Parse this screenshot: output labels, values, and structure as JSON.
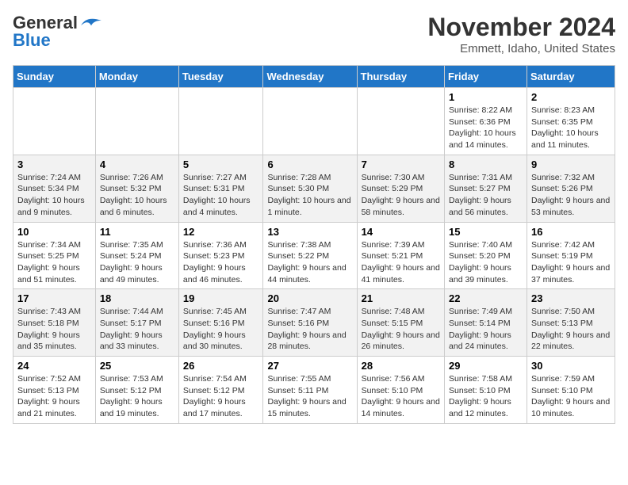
{
  "logo": {
    "general": "General",
    "blue": "Blue"
  },
  "title": "November 2024",
  "location": "Emmett, Idaho, United States",
  "days_of_week": [
    "Sunday",
    "Monday",
    "Tuesday",
    "Wednesday",
    "Thursday",
    "Friday",
    "Saturday"
  ],
  "weeks": [
    [
      {
        "day": "",
        "info": ""
      },
      {
        "day": "",
        "info": ""
      },
      {
        "day": "",
        "info": ""
      },
      {
        "day": "",
        "info": ""
      },
      {
        "day": "",
        "info": ""
      },
      {
        "day": "1",
        "info": "Sunrise: 8:22 AM\nSunset: 6:36 PM\nDaylight: 10 hours and 14 minutes."
      },
      {
        "day": "2",
        "info": "Sunrise: 8:23 AM\nSunset: 6:35 PM\nDaylight: 10 hours and 11 minutes."
      }
    ],
    [
      {
        "day": "3",
        "info": "Sunrise: 7:24 AM\nSunset: 5:34 PM\nDaylight: 10 hours and 9 minutes."
      },
      {
        "day": "4",
        "info": "Sunrise: 7:26 AM\nSunset: 5:32 PM\nDaylight: 10 hours and 6 minutes."
      },
      {
        "day": "5",
        "info": "Sunrise: 7:27 AM\nSunset: 5:31 PM\nDaylight: 10 hours and 4 minutes."
      },
      {
        "day": "6",
        "info": "Sunrise: 7:28 AM\nSunset: 5:30 PM\nDaylight: 10 hours and 1 minute."
      },
      {
        "day": "7",
        "info": "Sunrise: 7:30 AM\nSunset: 5:29 PM\nDaylight: 9 hours and 58 minutes."
      },
      {
        "day": "8",
        "info": "Sunrise: 7:31 AM\nSunset: 5:27 PM\nDaylight: 9 hours and 56 minutes."
      },
      {
        "day": "9",
        "info": "Sunrise: 7:32 AM\nSunset: 5:26 PM\nDaylight: 9 hours and 53 minutes."
      }
    ],
    [
      {
        "day": "10",
        "info": "Sunrise: 7:34 AM\nSunset: 5:25 PM\nDaylight: 9 hours and 51 minutes."
      },
      {
        "day": "11",
        "info": "Sunrise: 7:35 AM\nSunset: 5:24 PM\nDaylight: 9 hours and 49 minutes."
      },
      {
        "day": "12",
        "info": "Sunrise: 7:36 AM\nSunset: 5:23 PM\nDaylight: 9 hours and 46 minutes."
      },
      {
        "day": "13",
        "info": "Sunrise: 7:38 AM\nSunset: 5:22 PM\nDaylight: 9 hours and 44 minutes."
      },
      {
        "day": "14",
        "info": "Sunrise: 7:39 AM\nSunset: 5:21 PM\nDaylight: 9 hours and 41 minutes."
      },
      {
        "day": "15",
        "info": "Sunrise: 7:40 AM\nSunset: 5:20 PM\nDaylight: 9 hours and 39 minutes."
      },
      {
        "day": "16",
        "info": "Sunrise: 7:42 AM\nSunset: 5:19 PM\nDaylight: 9 hours and 37 minutes."
      }
    ],
    [
      {
        "day": "17",
        "info": "Sunrise: 7:43 AM\nSunset: 5:18 PM\nDaylight: 9 hours and 35 minutes."
      },
      {
        "day": "18",
        "info": "Sunrise: 7:44 AM\nSunset: 5:17 PM\nDaylight: 9 hours and 33 minutes."
      },
      {
        "day": "19",
        "info": "Sunrise: 7:45 AM\nSunset: 5:16 PM\nDaylight: 9 hours and 30 minutes."
      },
      {
        "day": "20",
        "info": "Sunrise: 7:47 AM\nSunset: 5:16 PM\nDaylight: 9 hours and 28 minutes."
      },
      {
        "day": "21",
        "info": "Sunrise: 7:48 AM\nSunset: 5:15 PM\nDaylight: 9 hours and 26 minutes."
      },
      {
        "day": "22",
        "info": "Sunrise: 7:49 AM\nSunset: 5:14 PM\nDaylight: 9 hours and 24 minutes."
      },
      {
        "day": "23",
        "info": "Sunrise: 7:50 AM\nSunset: 5:13 PM\nDaylight: 9 hours and 22 minutes."
      }
    ],
    [
      {
        "day": "24",
        "info": "Sunrise: 7:52 AM\nSunset: 5:13 PM\nDaylight: 9 hours and 21 minutes."
      },
      {
        "day": "25",
        "info": "Sunrise: 7:53 AM\nSunset: 5:12 PM\nDaylight: 9 hours and 19 minutes."
      },
      {
        "day": "26",
        "info": "Sunrise: 7:54 AM\nSunset: 5:12 PM\nDaylight: 9 hours and 17 minutes."
      },
      {
        "day": "27",
        "info": "Sunrise: 7:55 AM\nSunset: 5:11 PM\nDaylight: 9 hours and 15 minutes."
      },
      {
        "day": "28",
        "info": "Sunrise: 7:56 AM\nSunset: 5:10 PM\nDaylight: 9 hours and 14 minutes."
      },
      {
        "day": "29",
        "info": "Sunrise: 7:58 AM\nSunset: 5:10 PM\nDaylight: 9 hours and 12 minutes."
      },
      {
        "day": "30",
        "info": "Sunrise: 7:59 AM\nSunset: 5:10 PM\nDaylight: 9 hours and 10 minutes."
      }
    ]
  ]
}
